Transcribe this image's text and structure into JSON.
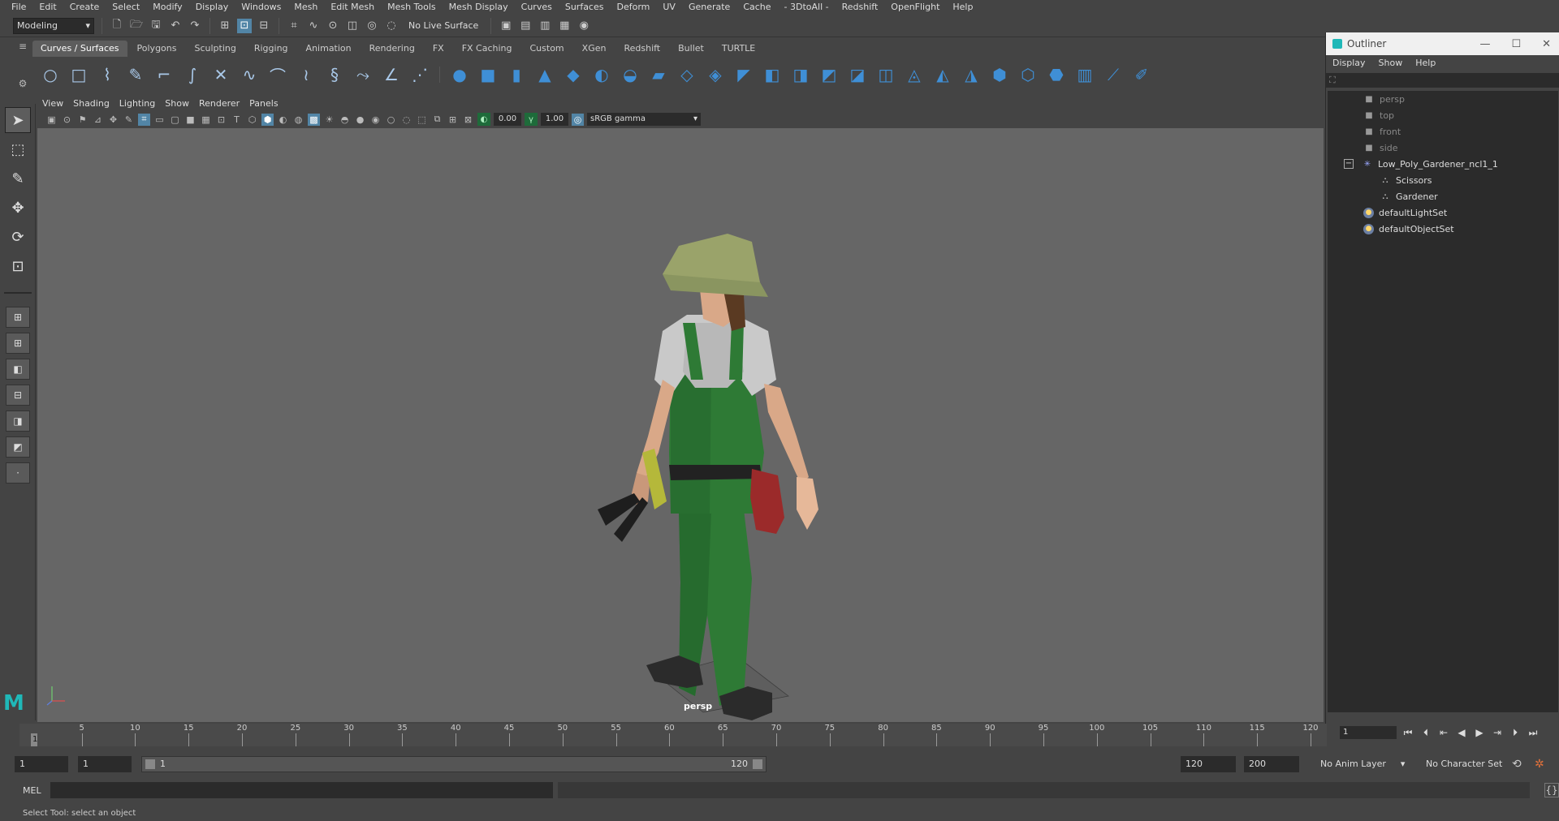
{
  "menubar": [
    "File",
    "Edit",
    "Create",
    "Select",
    "Modify",
    "Display",
    "Windows",
    "Mesh",
    "Edit Mesh",
    "Mesh Tools",
    "Mesh Display",
    "Curves",
    "Surfaces",
    "Deform",
    "UV",
    "Generate",
    "Cache",
    "- 3DtoAll -",
    "Redshift",
    "OpenFlight",
    "Help"
  ],
  "statusline": {
    "mode": "Modeling",
    "live_surface": "No Live Surface"
  },
  "shelf": {
    "tabs": [
      "Curves / Surfaces",
      "Polygons",
      "Sculpting",
      "Rigging",
      "Animation",
      "Rendering",
      "FX",
      "FX Caching",
      "Custom",
      "XGen",
      "Redshift",
      "Bullet",
      "TURTLE"
    ],
    "active_tab": 0
  },
  "viewport": {
    "menu": [
      "View",
      "Shading",
      "Lighting",
      "Show",
      "Renderer",
      "Panels"
    ],
    "exposure": "0.00",
    "gamma": "1.00",
    "color_space": "sRGB gamma",
    "camera_label": "persp",
    "colors": {
      "background": "#666666",
      "overalls": "#2e7a35",
      "shirt": "#c9c9c9",
      "skin": "#d9a888",
      "hat": "#9aa36a"
    }
  },
  "outliner": {
    "title": "Outliner",
    "menu": [
      "Display",
      "Show",
      "Help"
    ],
    "items": [
      {
        "label": "persp",
        "kind": "camera"
      },
      {
        "label": "top",
        "kind": "camera"
      },
      {
        "label": "front",
        "kind": "camera"
      },
      {
        "label": "side",
        "kind": "camera"
      },
      {
        "label": "Low_Poly_Gardener_ncl1_1",
        "kind": "group"
      },
      {
        "label": "Scissors",
        "kind": "child"
      },
      {
        "label": "Gardener",
        "kind": "child"
      },
      {
        "label": "defaultLightSet",
        "kind": "set"
      },
      {
        "label": "defaultObjectSet",
        "kind": "set"
      }
    ]
  },
  "timeslider": {
    "current_frame": "1",
    "ticks": [
      "5",
      "10",
      "15",
      "20",
      "25",
      "30",
      "35",
      "40",
      "45",
      "50",
      "55",
      "60",
      "65",
      "70",
      "75",
      "80",
      "85",
      "90",
      "95",
      "100",
      "105",
      "110",
      "115",
      "120"
    ],
    "frame_field": "1"
  },
  "rangeslider": {
    "start_a": "1",
    "start_b": "1",
    "range_start_label": "1",
    "range_end_label": "120",
    "end_a": "120",
    "end_b": "200",
    "anim_layer": "No Anim Layer",
    "character_set": "No Character Set"
  },
  "cmdline": {
    "label": "MEL"
  },
  "helpline": "Select Tool: select an object"
}
